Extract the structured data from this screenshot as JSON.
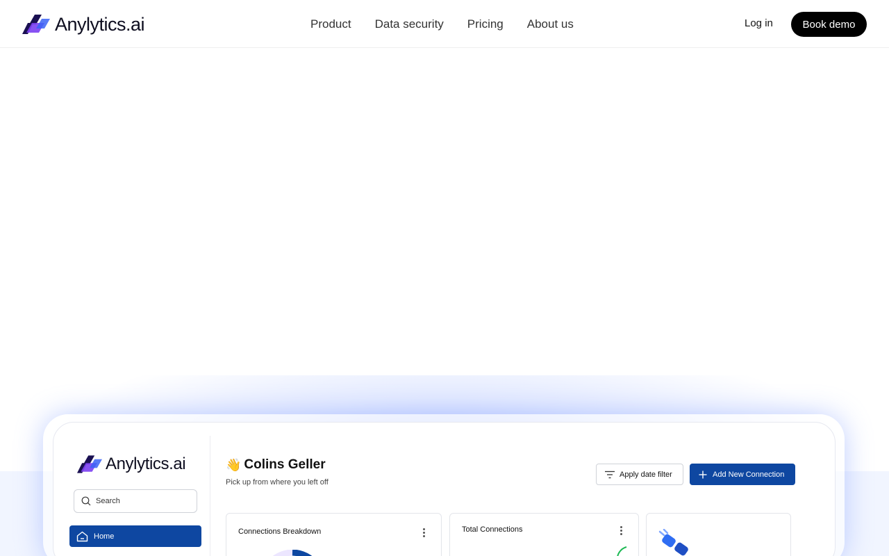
{
  "brand": {
    "name": "Anylytics.ai"
  },
  "nav": {
    "items": [
      "Product",
      "Data security",
      "Pricing",
      "About us"
    ]
  },
  "actions": {
    "login": "Log in",
    "book_demo": "Book demo"
  },
  "dashboard": {
    "brand_name": "Anylytics.ai",
    "search_placeholder": "Search",
    "sidebar": {
      "home": "Home"
    },
    "greeting": {
      "emoji": "👋",
      "name": "Colins Geller",
      "subtitle": "Pick up from where you left off"
    },
    "buttons": {
      "date_filter": "Apply date filter",
      "add_connection": "Add New Connection"
    },
    "cards": {
      "breakdown": "Connections Breakdown",
      "total": "Total Connections"
    }
  },
  "colors": {
    "primary": "#0e47a1",
    "logo_dark": "#1a1052",
    "logo_purple": "#7b3ff2",
    "logo_blue": "#3b63f5"
  }
}
